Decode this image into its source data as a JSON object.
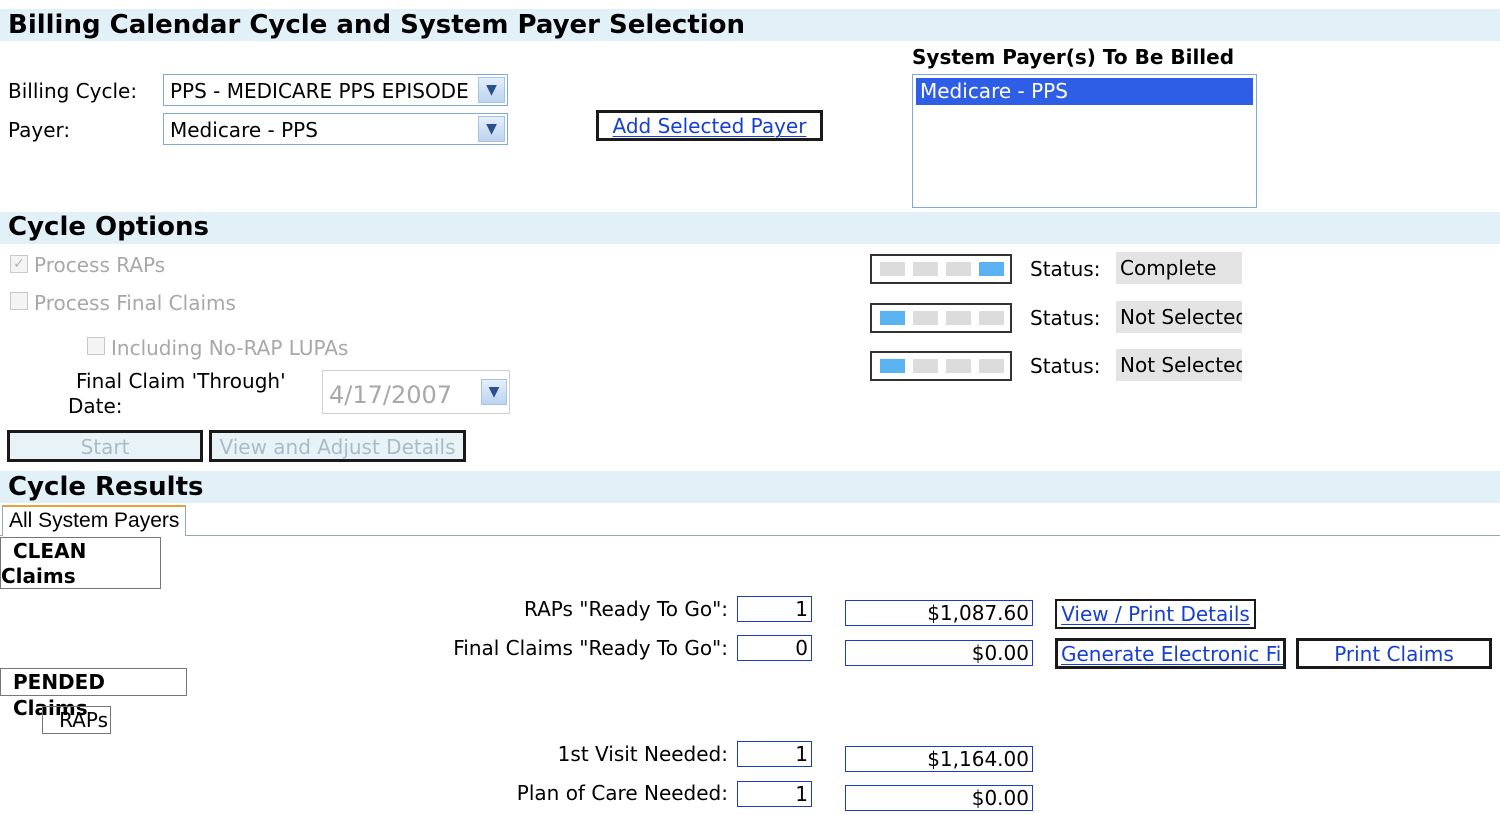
{
  "billing": {
    "title": "Billing Calendar Cycle and System Payer Selection",
    "cycle_label": "Billing Cycle:",
    "cycle_value": "PPS - MEDICARE PPS EPISODE",
    "payer_label": "Payer:",
    "payer_value": "Medicare - PPS",
    "add_payer_button": "Add Selected Payer",
    "payers_list_title": "System Payer(s) To Be Billed",
    "payers_list": [
      "Medicare - PPS"
    ]
  },
  "cycle_options": {
    "title": "Cycle Options",
    "process_raps": "Process RAPs",
    "process_raps_checked": true,
    "process_final": "Process Final Claims",
    "process_final_checked": false,
    "no_rap_lupas": "Including No-RAP LUPAs",
    "no_rap_lupas_checked": false,
    "through_label_1": "Final Claim 'Through'",
    "through_label_2": "Date:",
    "through_date": "4/17/2007",
    "start_button": "Start",
    "view_adjust_button": "View and Adjust Details",
    "statuses": [
      {
        "label": "Status:",
        "value": "Complete",
        "progress_segments_filled": [
          4
        ]
      },
      {
        "label": "Status:",
        "value": "Not Selected",
        "progress_segments_filled": [
          1
        ]
      },
      {
        "label": "Status:",
        "value": "Not Selected",
        "progress_segments_filled": [
          1
        ]
      }
    ]
  },
  "cycle_results": {
    "title": "Cycle Results",
    "tab": "All System Payers",
    "clean_label_1": "CLEAN",
    "clean_label_2": "Claims",
    "raps_ready_label": "RAPs \"Ready To Go\":",
    "raps_ready_count": "1",
    "raps_ready_amount": "$1,087.60",
    "view_print_button": "View / Print Details",
    "final_ready_label": "Final Claims \"Ready To Go\":",
    "final_ready_count": "0",
    "final_ready_amount": "$0.00",
    "generate_button": "Generate Electronic File",
    "print_button": "Print Claims",
    "pended_label": "PENDED Claims",
    "raps_sub_label": "RAPs",
    "first_visit_label": "1st Visit Needed:",
    "first_visit_count": "1",
    "first_visit_amount": "$1,164.00",
    "plan_care_label": "Plan of Care Needed:",
    "plan_care_count": "1",
    "plan_care_amount": "$0.00"
  },
  "colors": {
    "section_bar": "#e2f1f8",
    "link_blue": "#1840d0",
    "progress_fill": "#5ab3f0",
    "list_selected": "#2e5ee6"
  }
}
